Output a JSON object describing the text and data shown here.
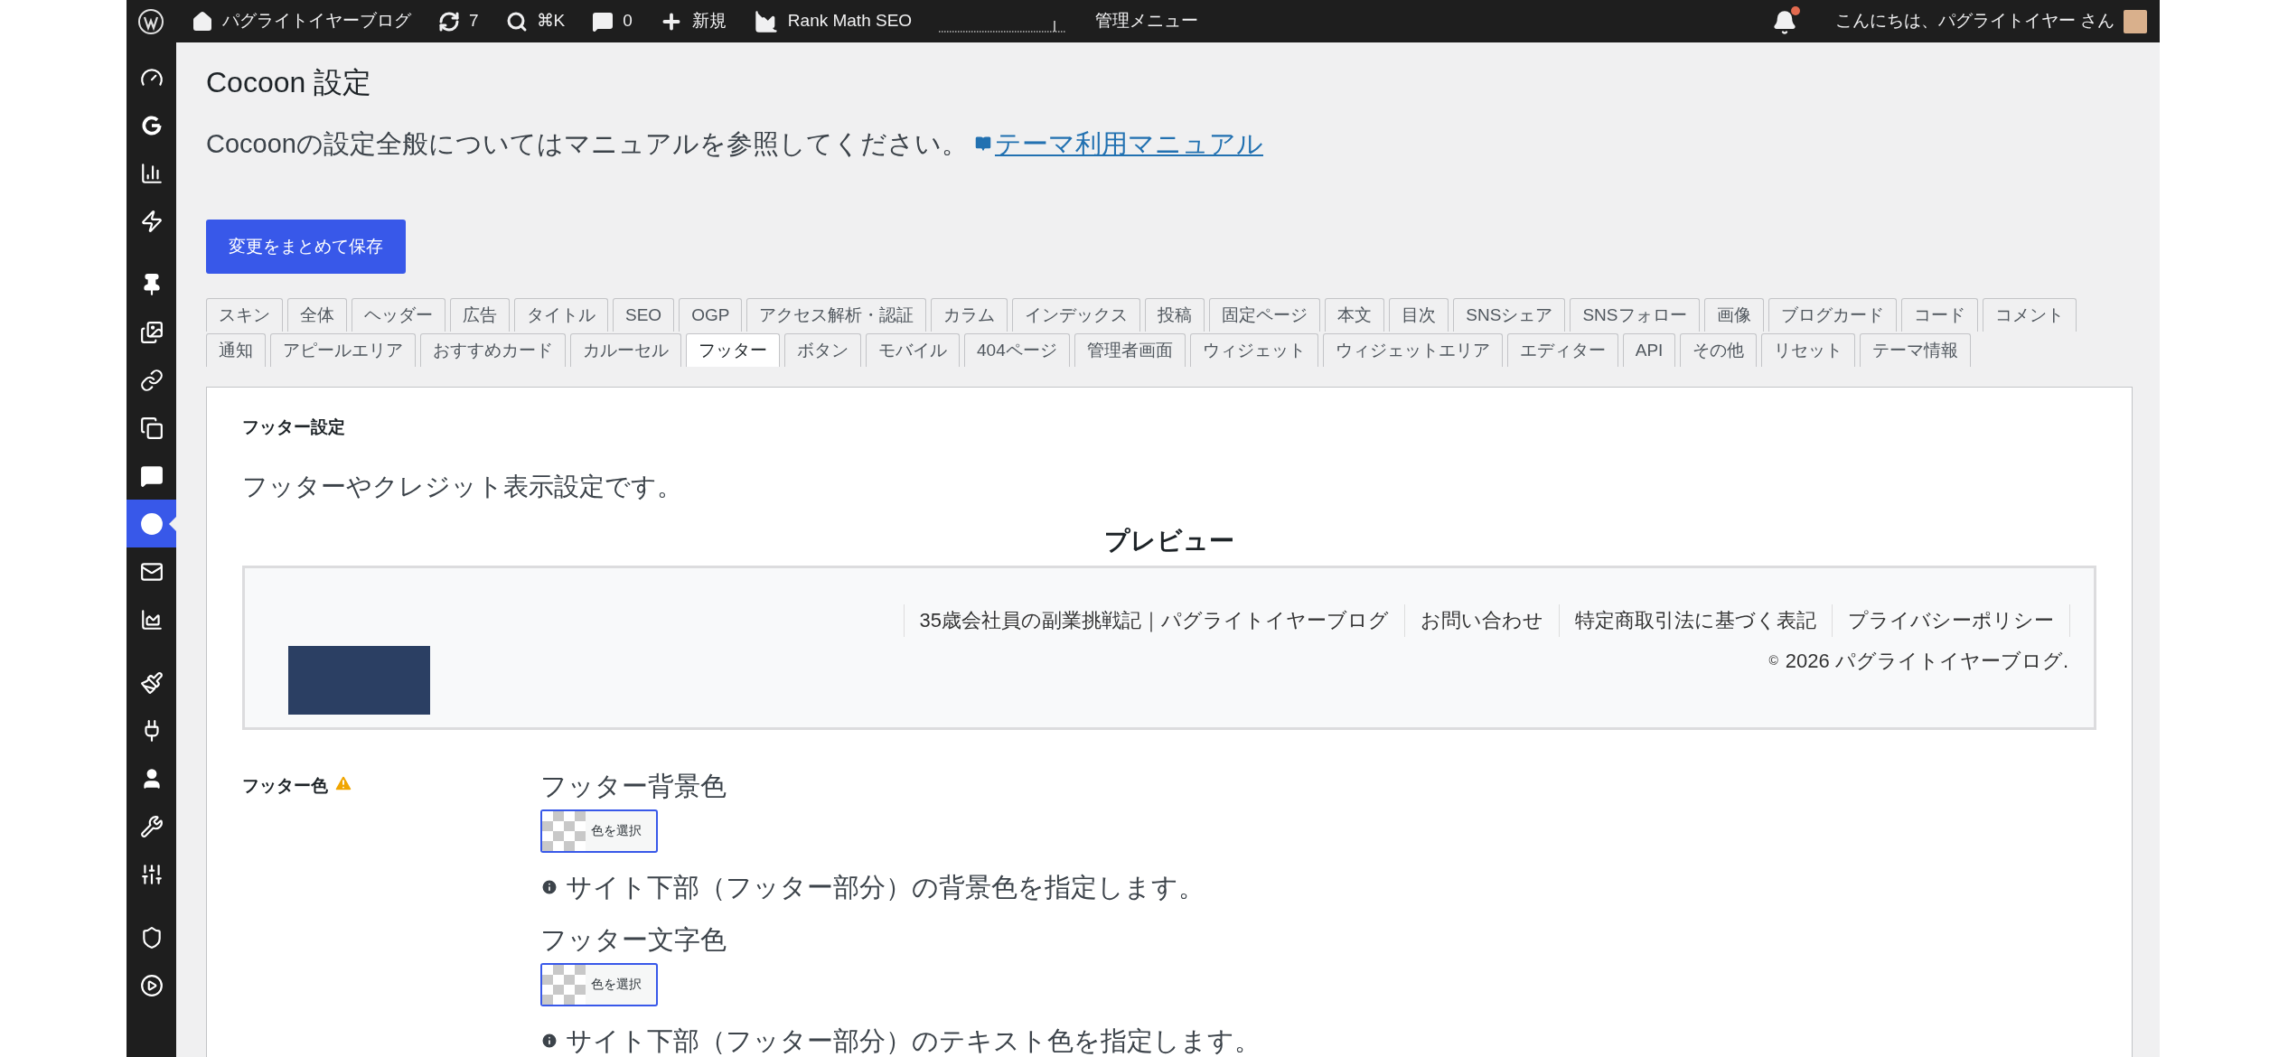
{
  "admin_bar": {
    "site_name": "パグライトイヤーブログ",
    "updates": "7",
    "search_shortcut": "⌘K",
    "comments": "0",
    "new": "新規",
    "seo_plugin": "Rank Math SEO",
    "admin_menu": "管理メニュー",
    "greeting": "こんにちは、パグライトイヤー さん",
    "notification_unread": true
  },
  "sidebar": {
    "groups": [
      [
        {
          "kind": "gauge",
          "selected": false
        },
        {
          "kind": "g",
          "selected": false
        },
        {
          "kind": "chart",
          "selected": false
        },
        {
          "kind": "bolt",
          "selected": false
        }
      ],
      [
        {
          "kind": "pin",
          "selected": false
        },
        {
          "kind": "media",
          "selected": false
        },
        {
          "kind": "link",
          "selected": false
        },
        {
          "kind": "pages",
          "selected": false
        },
        {
          "kind": "comment",
          "selected": false
        },
        {
          "kind": "cocoon",
          "selected": true
        },
        {
          "kind": "mail",
          "selected": false
        },
        {
          "kind": "rank",
          "selected": false
        }
      ],
      [
        {
          "kind": "brush",
          "selected": false
        },
        {
          "kind": "plug",
          "selected": false
        },
        {
          "kind": "user",
          "selected": false
        },
        {
          "kind": "wrench",
          "selected": false
        },
        {
          "kind": "sliders",
          "selected": false
        }
      ],
      [
        {
          "kind": "shield",
          "selected": false
        },
        {
          "kind": "play",
          "selected": false
        }
      ]
    ]
  },
  "page": {
    "title": "Cocoon 設定",
    "intro": "Cocoonの設定全般についてはマニュアルを参照してください。",
    "manual_link": "テーマ利用マニュアル",
    "save_button": "変更をまとめて保存"
  },
  "tab_rows": [
    [
      {
        "label": "スキン",
        "selected": false
      },
      {
        "label": "全体",
        "selected": false
      },
      {
        "label": "ヘッダー",
        "selected": false
      },
      {
        "label": "広告",
        "selected": false
      },
      {
        "label": "タイトル",
        "selected": false
      },
      {
        "label": "SEO",
        "selected": false
      },
      {
        "label": "OGP",
        "selected": false
      },
      {
        "label": "アクセス解析・認証",
        "selected": false
      },
      {
        "label": "カラム",
        "selected": false
      },
      {
        "label": "インデックス",
        "selected": false
      },
      {
        "label": "投稿",
        "selected": false
      },
      {
        "label": "固定ページ",
        "selected": false
      },
      {
        "label": "本文",
        "selected": false
      },
      {
        "label": "目次",
        "selected": false
      },
      {
        "label": "SNSシェア",
        "selected": false
      },
      {
        "label": "SNSフォロー",
        "selected": false
      },
      {
        "label": "画像",
        "selected": false
      },
      {
        "label": "ブログカード",
        "selected": false
      },
      {
        "label": "コード",
        "selected": false
      },
      {
        "label": "コメント",
        "selected": false
      }
    ],
    [
      {
        "label": "通知",
        "selected": false
      },
      {
        "label": "アピールエリア",
        "selected": false
      },
      {
        "label": "おすすめカード",
        "selected": false
      },
      {
        "label": "カルーセル",
        "selected": false
      },
      {
        "label": "フッター",
        "selected": true
      },
      {
        "label": "ボタン",
        "selected": false
      },
      {
        "label": "モバイル",
        "selected": false
      },
      {
        "label": "404ページ",
        "selected": false
      },
      {
        "label": "管理者画面",
        "selected": false
      },
      {
        "label": "ウィジェット",
        "selected": false
      },
      {
        "label": "ウィジェットエリア",
        "selected": false
      },
      {
        "label": "エディター",
        "selected": false
      },
      {
        "label": "API",
        "selected": false
      },
      {
        "label": "その他",
        "selected": false
      },
      {
        "label": "リセット",
        "selected": false
      },
      {
        "label": "テーマ情報",
        "selected": false
      }
    ]
  ],
  "panel": {
    "heading": "フッター設定",
    "description": "フッターやクレジット表示設定です。",
    "preview_title": "プレビュー",
    "preview": {
      "links": [
        "35歳会社員の副業挑戦記｜パグライトイヤーブログ",
        "お問い合わせ",
        "特定商取引法に基づく表記",
        "プライバシーポリシー"
      ],
      "copyright_mark": "©",
      "copyright": "2026 パグライトイヤーブログ."
    },
    "section_label": "フッター色",
    "section_warning": true,
    "fields": [
      {
        "label": "フッター背景色",
        "button": "色を選択",
        "help": "サイト下部（フッター部分）の背景色を指定します。"
      },
      {
        "label": "フッター文字色",
        "button": "色を選択",
        "help": "サイト下部（フッター部分）のテキスト色を指定します。"
      }
    ]
  }
}
